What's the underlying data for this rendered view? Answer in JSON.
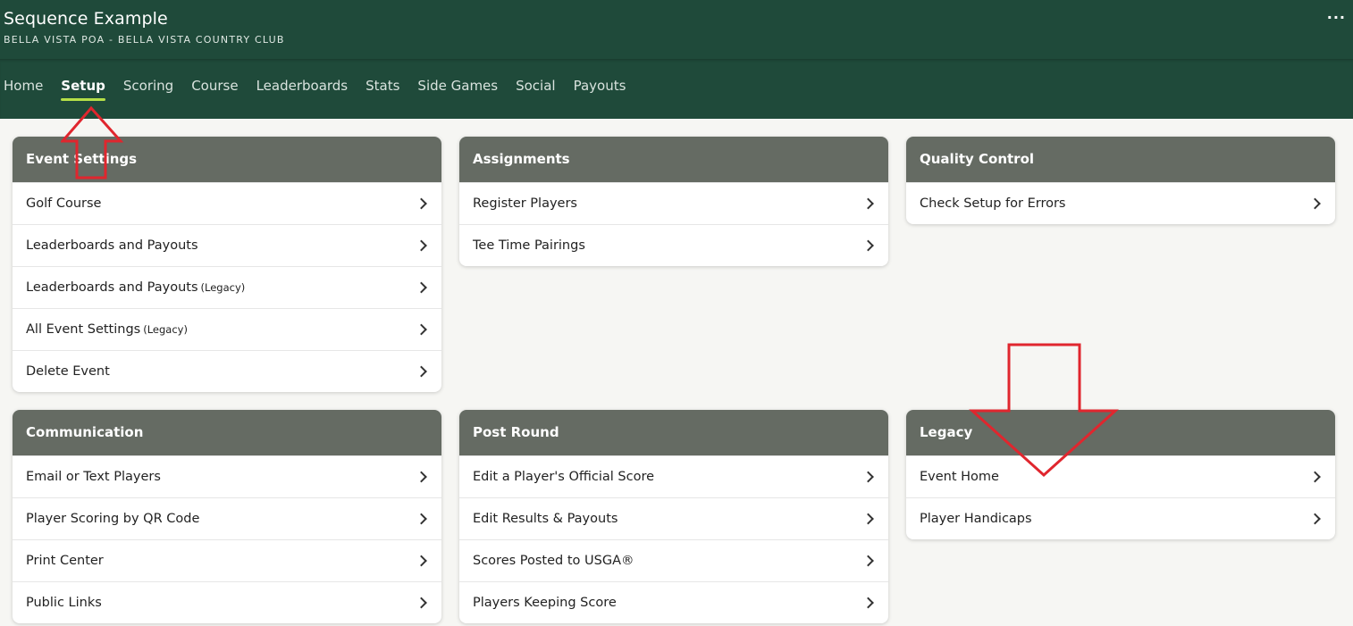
{
  "header": {
    "title": "Sequence Example",
    "subtitle": "BELLA VISTA POA - BELLA VISTA COUNTRY CLUB",
    "more_label": "···"
  },
  "nav": {
    "items": [
      "Home",
      "Setup",
      "Scoring",
      "Course",
      "Leaderboards",
      "Stats",
      "Side Games",
      "Social",
      "Payouts"
    ],
    "active": "Setup"
  },
  "cards": {
    "event_settings": {
      "title": "Event Settings",
      "rows": [
        "Golf Course",
        "Leaderboards and Payouts",
        "Leaderboards and Payouts",
        "All Event Settings",
        "Delete Event"
      ],
      "legacy_tag": "(Legacy)"
    },
    "assignments": {
      "title": "Assignments",
      "rows": [
        "Register Players",
        "Tee Time Pairings"
      ]
    },
    "quality_control": {
      "title": "Quality Control",
      "rows": [
        "Check Setup for Errors"
      ]
    },
    "communication": {
      "title": "Communication",
      "rows": [
        "Email or Text Players",
        "Player Scoring by QR Code",
        "Print Center",
        "Public Links"
      ]
    },
    "post_round": {
      "title": "Post Round",
      "rows": [
        "Edit a Player's Official Score",
        "Edit Results & Payouts",
        "Scores Posted to USGA®",
        "Players Keeping Score"
      ]
    },
    "legacy": {
      "title": "Legacy",
      "rows": [
        "Event Home",
        "Player Handicaps"
      ]
    }
  },
  "colors": {
    "header_bg": "#1f4a3a",
    "card_header_bg": "#656b63",
    "active_underline": "#b5e048",
    "annotation_arrow": "#e0262e"
  }
}
